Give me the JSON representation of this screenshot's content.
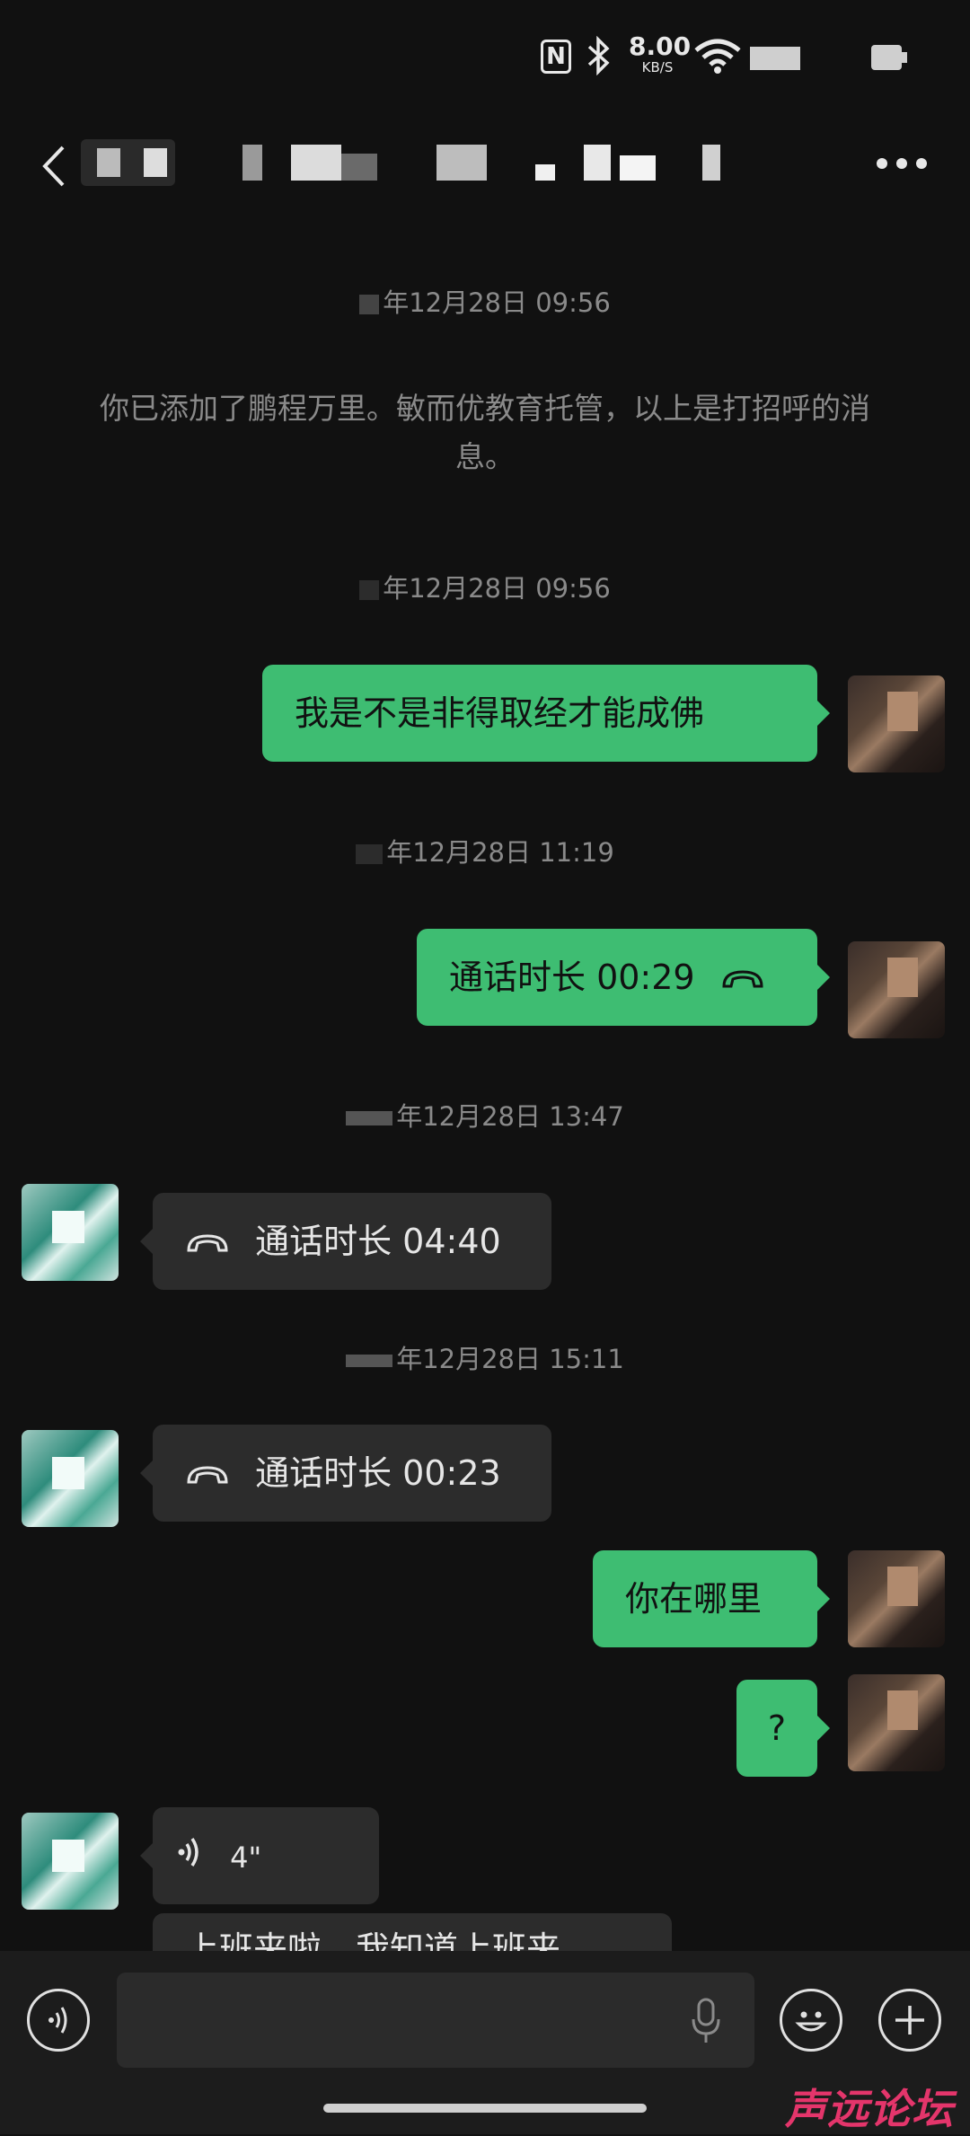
{
  "status_bar": {
    "speed_value": "8.00",
    "speed_unit": "KB/S",
    "nfc_label": "N"
  },
  "header": {
    "more_label": "more"
  },
  "messages": {
    "ts1": "年12月28日 09:56",
    "system_notice": "你已添加了鹏程万里。敏而优教育托管，以上是打招呼的消息。",
    "ts2": "年12月28日 09:56",
    "m1": "我是不是非得取经才能成佛",
    "ts3": "年12月28日 11:19",
    "m2": "通话时长 00:29",
    "ts4": "年12月28日 13:47",
    "m3": "通话时长 04:40",
    "ts5": "年12月28日 15:11",
    "m4": "通话时长 00:23",
    "m5": "你在哪里",
    "m6": "?",
    "m7": "4\"",
    "m8_partial": "上班来啦，我知道上班来"
  },
  "watermark": "声远论坛",
  "colors": {
    "outgoing_bubble": "#3ebd72",
    "incoming_bubble": "#2c2c2c",
    "background": "#111111"
  }
}
